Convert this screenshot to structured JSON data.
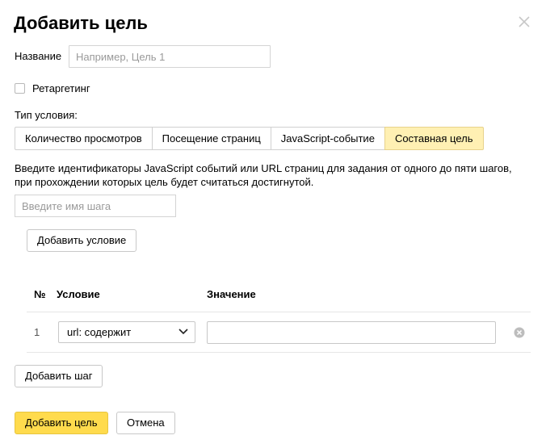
{
  "dialog": {
    "title": "Добавить цель",
    "close_icon": "close-icon"
  },
  "name": {
    "label": "Название",
    "placeholder": "Например, Цель 1",
    "value": ""
  },
  "retargeting": {
    "label": "Ретаргетинг",
    "checked": false
  },
  "condition_type": {
    "label": "Тип условия:",
    "tabs": [
      {
        "label": "Количество просмотров",
        "active": false
      },
      {
        "label": "Посещение страниц",
        "active": false
      },
      {
        "label": "JavaScript-событие",
        "active": false
      },
      {
        "label": "Составная цель",
        "active": true
      }
    ]
  },
  "description": "Введите идентификаторы JavaScript событий или URL страниц для задания от одного до пяти шагов, при прохождении которых цель будет считаться достигнутой.",
  "step": {
    "placeholder": "Введите имя шага",
    "value": "",
    "add_condition_label": "Добавить условие"
  },
  "table": {
    "headers": {
      "no": "№",
      "condition": "Условие",
      "value": "Значение"
    },
    "rows": [
      {
        "no": "1",
        "condition": "url: содержит",
        "value": ""
      }
    ]
  },
  "add_step_label": "Добавить шаг",
  "footer": {
    "submit_label": "Добавить цель",
    "cancel_label": "Отмена"
  },
  "colors": {
    "active_tab": "#fff0b3",
    "primary_button": "#ffdb4d"
  }
}
